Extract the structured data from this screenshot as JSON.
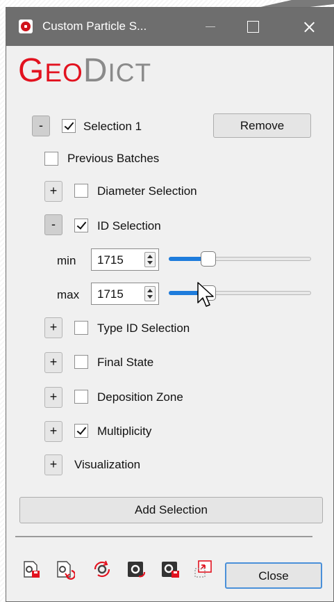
{
  "window": {
    "title": "Custom Particle S...",
    "controls": {
      "minimize": "minimize-button",
      "maximize": "maximize-button",
      "close": "close-window-button"
    }
  },
  "logo": {
    "geo_first": "G",
    "geo_rest": "EO",
    "dict_first": "D",
    "dict_rest": "ICT"
  },
  "selection": {
    "collapse_symbol": "-",
    "checked": true,
    "label": "Selection 1",
    "remove_label": "Remove",
    "previous_batches": {
      "label": "Previous Batches",
      "checked": false
    },
    "diameter_selection": {
      "expand_symbol": "+",
      "label": "Diameter Selection",
      "checked": false
    },
    "id_selection": {
      "collapse_symbol": "-",
      "label": "ID Selection",
      "checked": true,
      "min": {
        "label": "min",
        "value": "1715",
        "slider_fraction": 0.25
      },
      "max": {
        "label": "max",
        "value": "1715",
        "slider_fraction": 0.25
      }
    },
    "type_id_selection": {
      "expand_symbol": "+",
      "label": "Type ID Selection",
      "checked": false
    },
    "final_state": {
      "expand_symbol": "+",
      "label": "Final State",
      "checked": false
    },
    "deposition_zone": {
      "expand_symbol": "+",
      "label": "Deposition Zone",
      "checked": false
    },
    "multiplicity": {
      "expand_symbol": "+",
      "label": "Multiplicity",
      "checked": true
    },
    "visualization": {
      "expand_symbol": "+",
      "label": "Visualization"
    }
  },
  "add_selection_label": "Add Selection",
  "toolbar": {
    "icons": [
      "load-settings-icon",
      "save-settings-icon",
      "reset-settings-icon",
      "apply-settings-icon",
      "export-settings-icon",
      "macro-record-icon"
    ],
    "close_label": "Close"
  },
  "colors": {
    "accent": "#1e7cdc",
    "brand_red": "#e2121f",
    "titlebar": "#6e6e6e"
  }
}
